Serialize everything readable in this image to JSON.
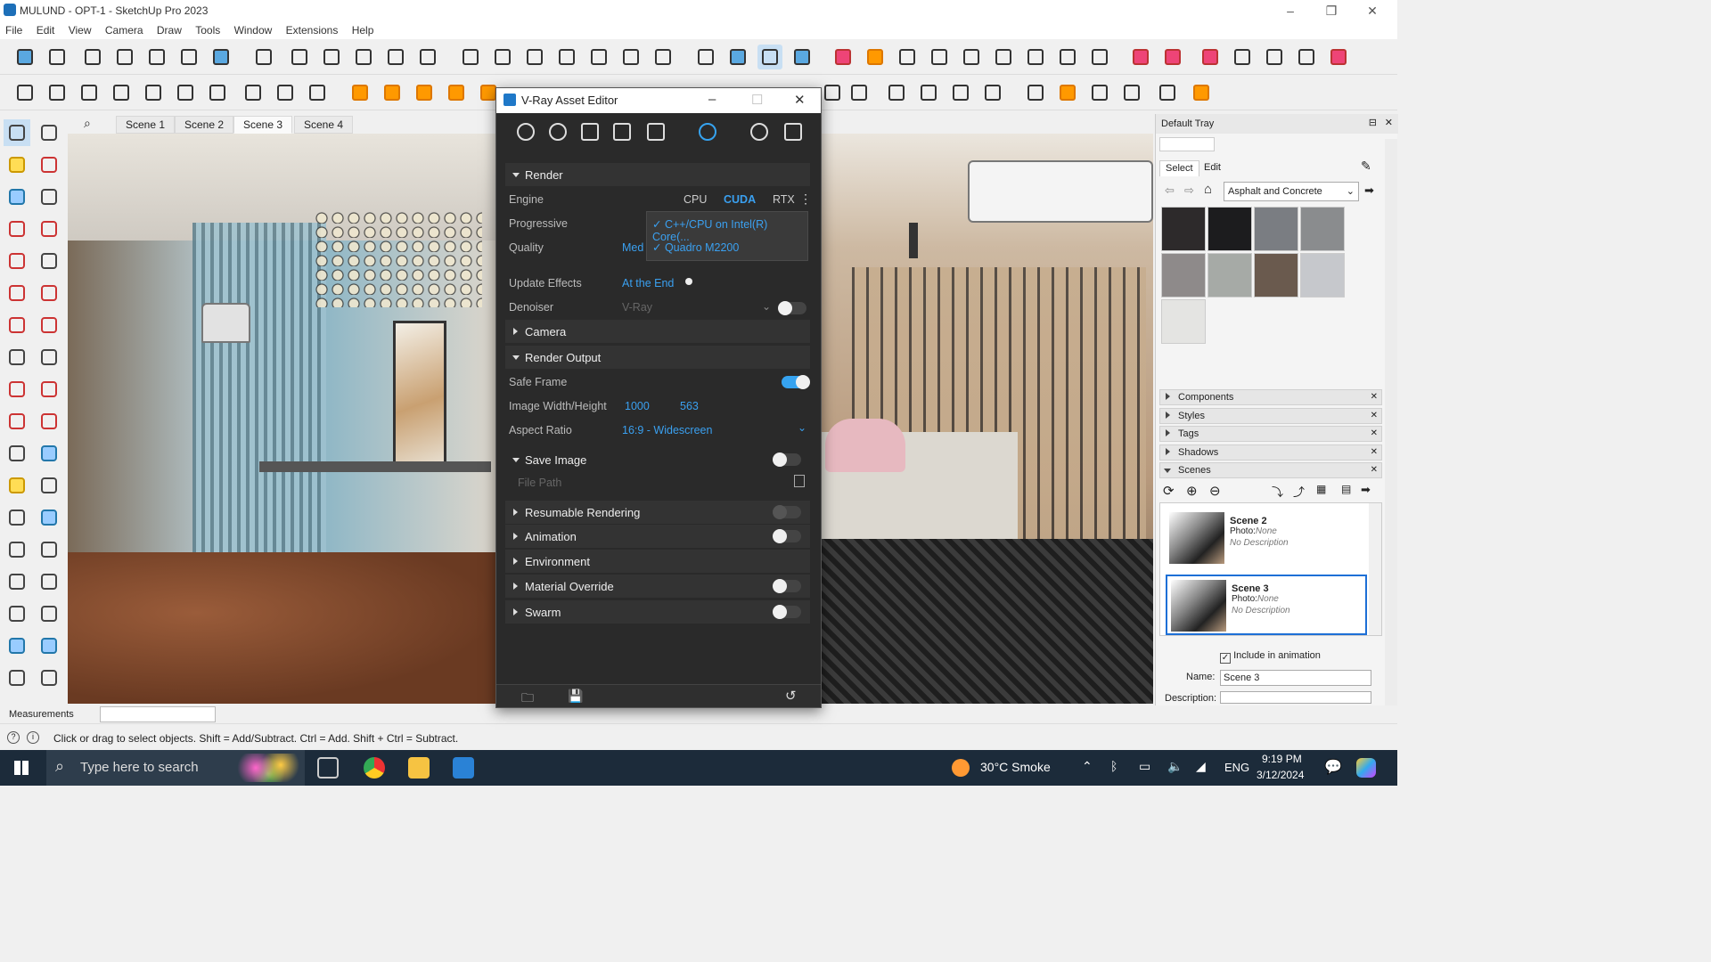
{
  "window": {
    "title": "MULUND - OPT-1 - SketchUp Pro 2023",
    "controls": [
      "–",
      "❐",
      "✕"
    ]
  },
  "menu": [
    "File",
    "Edit",
    "View",
    "Camera",
    "Draw",
    "Tools",
    "Window",
    "Extensions",
    "Help"
  ],
  "scene_tabs": {
    "tabs": [
      "Scene 1",
      "Scene 2",
      "Scene 3",
      "Scene 4"
    ],
    "active": "Scene 3"
  },
  "vray": {
    "title": "V-Ray Asset Editor",
    "sections": {
      "render": "Render",
      "camera": "Camera",
      "render_output": "Render Output",
      "save_image": "Save Image",
      "resumable": "Resumable Rendering",
      "animation": "Animation",
      "environment": "Environment",
      "material_override": "Material Override",
      "swarm": "Swarm"
    },
    "engine": {
      "label": "Engine",
      "options": [
        "CPU",
        "CUDA",
        "RTX"
      ],
      "selected": "CUDA"
    },
    "progressive": {
      "label": "Progressive"
    },
    "quality": {
      "label": "Quality",
      "value": "Med"
    },
    "devices": [
      "C++/CPU on Intel(R) Core(...",
      "Quadro M2200"
    ],
    "update_effects": {
      "label": "Update Effects",
      "value": "At the End"
    },
    "denoiser": {
      "label": "Denoiser",
      "value": "V-Ray",
      "enabled": false
    },
    "safe_frame": {
      "label": "Safe Frame",
      "enabled": true
    },
    "image_size": {
      "label": "Image Width/Height",
      "width": "1000",
      "height": "563"
    },
    "aspect_ratio": {
      "label": "Aspect Ratio",
      "value": "16:9 - Widescreen"
    },
    "file_path": {
      "placeholder": "File Path"
    }
  },
  "tray": {
    "title": "Default Tray",
    "tabs": [
      "Select",
      "Edit"
    ],
    "material_library": "Asphalt and Concrete",
    "swatch_colors": [
      "#2d2a2b",
      "#1c1c1e",
      "#7a7d82",
      "#8a8c8e",
      "#8e8a8a",
      "#a6aaa6",
      "#6a5a4e",
      "#c6c8cc",
      "#e4e4e2"
    ],
    "panels": [
      "Components",
      "Styles",
      "Tags",
      "Shadows",
      "Scenes"
    ],
    "scenes": [
      {
        "name": "Scene 2",
        "photo_label": "Photo:",
        "photo_value": "None",
        "description": "No Description"
      },
      {
        "name": "Scene 3",
        "photo_label": "Photo:",
        "photo_value": "None",
        "description": "No Description"
      }
    ],
    "include_in_animation": "Include in animation",
    "name_label": "Name:",
    "name_value": "Scene 3",
    "description_label": "Description:"
  },
  "measurements_label": "Measurements",
  "status_text": "Click or drag to select objects. Shift = Add/Subtract. Ctrl = Add. Shift + Ctrl = Subtract.",
  "taskbar": {
    "search_placeholder": "Type here to search",
    "weather": "30°C  Smoke",
    "language": "ENG",
    "time": "9:19 PM",
    "date": "3/12/2024"
  }
}
